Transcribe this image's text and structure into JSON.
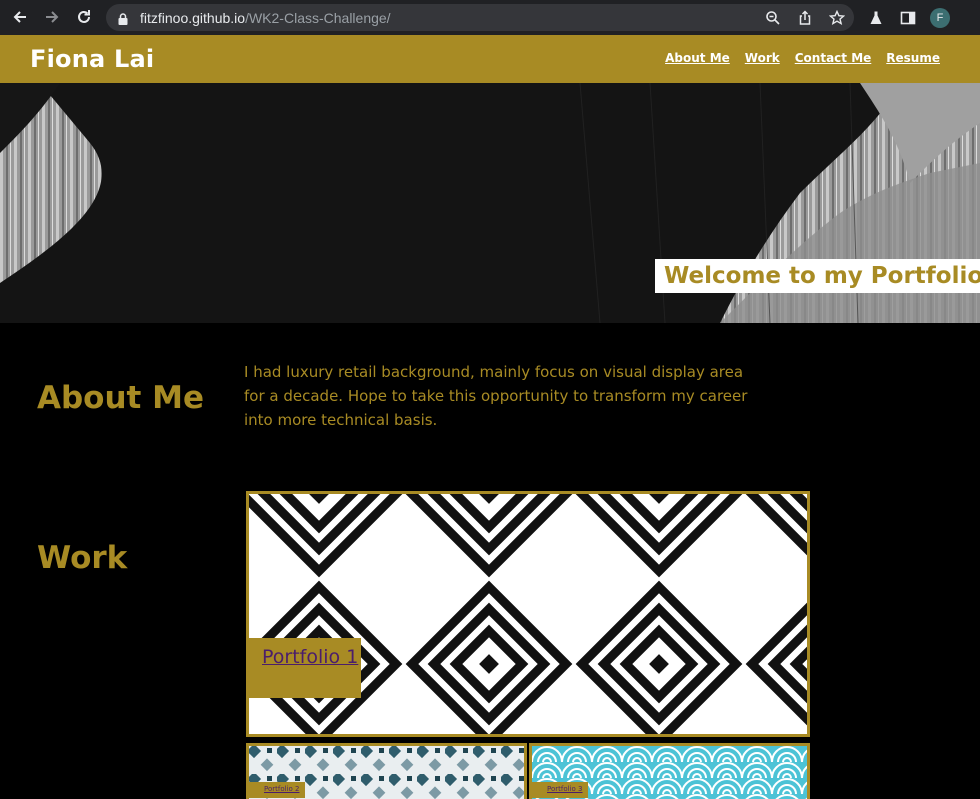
{
  "browser": {
    "url_host": "fitzfinoo.github.io",
    "url_path": "/WK2-Class-Challenge/",
    "profile_initial": "F",
    "icons": [
      "back-icon",
      "forward-icon",
      "reload-icon",
      "lock-icon",
      "zoom-icon",
      "share-icon",
      "bookmark-star-icon",
      "labs-flask-icon",
      "side-panel-icon"
    ]
  },
  "header": {
    "title": "Fiona Lai",
    "nav": [
      "About Me",
      "Work",
      "Contact Me",
      "Resume"
    ]
  },
  "hero": {
    "badge": "Welcome to my Portfolio!"
  },
  "about": {
    "heading": "About Me",
    "text": "I had luxury retail background, mainly focus on visual display area for a decade. Hope to take this opportunity to transform my career into more technical basis."
  },
  "work": {
    "heading": "Work",
    "portfolios": [
      {
        "label": "Portfolio 1"
      },
      {
        "label": "Portfolio 2"
      },
      {
        "label": "Portfolio 3"
      }
    ]
  },
  "colors": {
    "accent": "#a88b24",
    "background": "#000000",
    "link": "#4b1e6b"
  }
}
